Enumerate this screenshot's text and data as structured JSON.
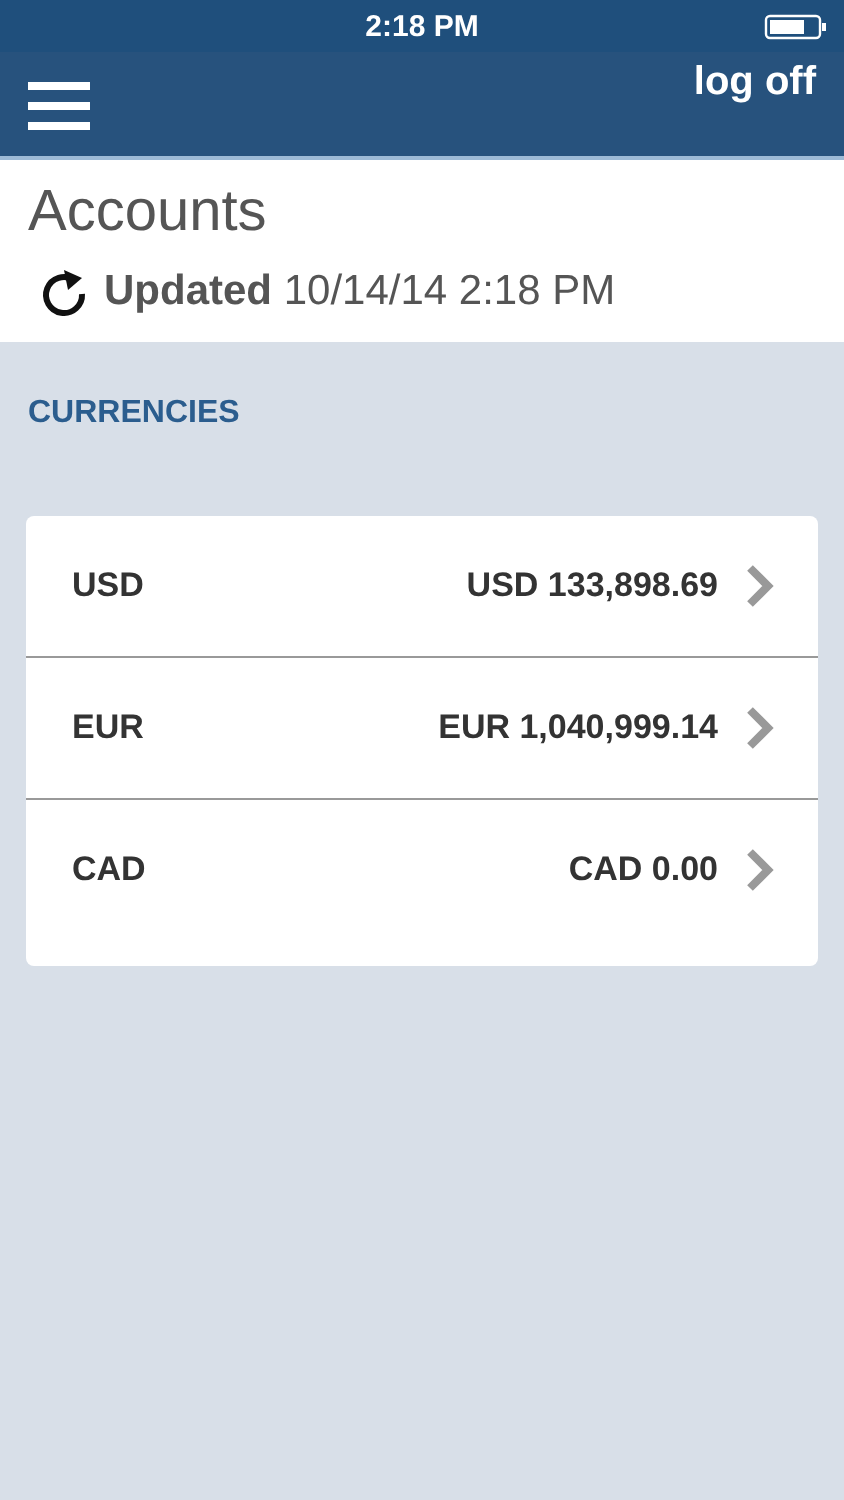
{
  "status_bar": {
    "time": "2:18 PM"
  },
  "nav_bar": {
    "action": "log off"
  },
  "header": {
    "title": "Accounts",
    "updated": "**Updated** 10/14/14 2:18 PM"
  },
  "section": {
    "title": "CURRENCIES"
  },
  "currencies": [
    {
      "code": "USD",
      "balance": "USD 133,898.69"
    },
    {
      "code": "EUR",
      "balance": "EUR 1,040,999.14"
    },
    {
      "code": "CAD",
      "balance": "CAD 0.00"
    }
  ]
}
